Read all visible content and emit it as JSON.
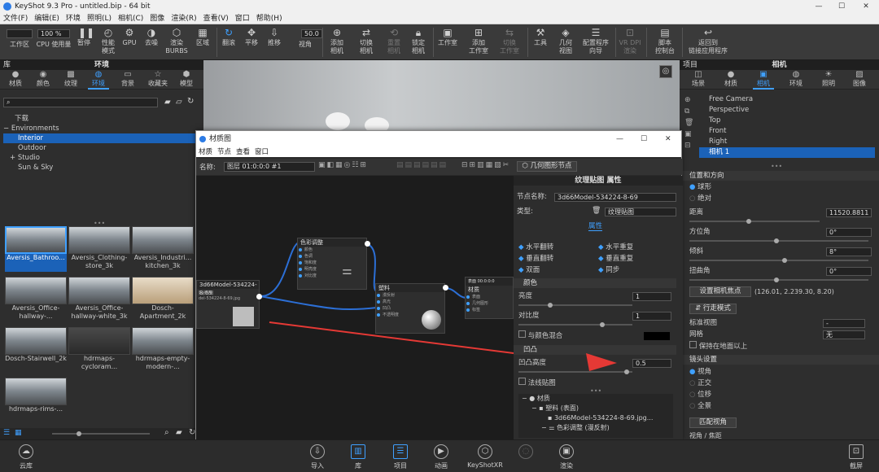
{
  "window": {
    "title": "KeyShot 9.3 Pro - untitled.bip - 64 bit"
  },
  "menu": [
    "文件(F)",
    "编辑(E)",
    "环境",
    "照明(L)",
    "相机(C)",
    "图像",
    "渲染(R)",
    "查看(V)",
    "窗口",
    "帮助(H)"
  ],
  "toolbar": {
    "zoom_value": "100 %",
    "fov_value": "50.0",
    "items": [
      {
        "label": "工作区",
        "icon": "workspace-icon"
      },
      {
        "label": "CPU 使用量",
        "icon": "cpu-icon"
      },
      {
        "label": "暂停",
        "icon": "pause-icon"
      },
      {
        "label": "性能\n模式",
        "icon": "performance-icon"
      },
      {
        "label": "GPU",
        "icon": "gpu-icon"
      },
      {
        "label": "去噪",
        "icon": "denoise-icon"
      },
      {
        "label": "渲染\nBURBS",
        "icon": "nurbs-icon"
      },
      {
        "label": "区域",
        "icon": "region-icon"
      },
      {
        "label": "翻滚",
        "icon": "tumble-icon"
      },
      {
        "label": "平移",
        "icon": "pan-icon"
      },
      {
        "label": "推移",
        "icon": "dolly-icon"
      },
      {
        "label": "视角",
        "icon": "view-icon"
      },
      {
        "label": "添加\n相机",
        "icon": "add-camera-icon"
      },
      {
        "label": "切换\n相机",
        "icon": "switch-camera-icon"
      },
      {
        "label": "重置\n相机",
        "icon": "reset-camera-icon"
      },
      {
        "label": "锁定\n相机",
        "icon": "lock-camera-icon"
      },
      {
        "label": "工作室",
        "icon": "studio-icon"
      },
      {
        "label": "添加\n工作室",
        "icon": "add-studio-icon"
      },
      {
        "label": "切换\n工作室",
        "icon": "switch-studio-icon"
      },
      {
        "label": "工具",
        "icon": "tools-icon"
      },
      {
        "label": "几何\n视图",
        "icon": "geometry-view-icon"
      },
      {
        "label": "配置程序\n向导",
        "icon": "configurator-icon"
      },
      {
        "label": "VR DPI\n渲染",
        "icon": "vr-icon"
      },
      {
        "label": "脚本\n控制台",
        "icon": "script-icon"
      },
      {
        "label": "返回到\n链接应用程序",
        "icon": "return-icon"
      }
    ]
  },
  "library": {
    "panel_title": "库",
    "title": "环境",
    "tabs": [
      "材质",
      "颜色",
      "纹理",
      "环境",
      "背景",
      "收藏夹",
      "模型"
    ],
    "tree": {
      "root": "下载",
      "group": "Environments",
      "items": [
        "Interior",
        "Outdoor",
        "Studio",
        "Sun & Sky"
      ]
    },
    "thumbs": [
      "Aversis_Bathroo...",
      "Aversis_Clothing-store_3k",
      "Aversis_Industri... kitchen_3k",
      "Aversis_Office-hallway-...",
      "Aversis_Office-hallway-white_3k",
      "Dosch-Apartment_2k",
      "Dosch-Stairwell_2k",
      "hdrmaps-cycloram...",
      "hdrmaps-empty-modern-...",
      "hdrmaps-rims-..."
    ]
  },
  "material_window": {
    "title": "材质图",
    "menu": [
      "材质",
      "节点",
      "查看",
      "窗口"
    ],
    "name_label": "名称:",
    "name_value": "图层 01:0:0:0 #1",
    "geometry_node_btn": "几何图形节点",
    "nodes": {
      "texture": {
        "title": "3d66Model-534224-8-69",
        "sub": "贴图图",
        "subtitle": "del-534224-8-69.jpg"
      },
      "color": {
        "title": "色彩调整",
        "inputs": [
          "颜色",
          "色调",
          "饱和度",
          "明亮度",
          "对比度",
          "▪"
        ]
      },
      "plastic": {
        "title": "塑料",
        "inputs": [
          "漫反射",
          "高光",
          "凹凸",
          "不透明度",
          "▪"
        ]
      },
      "material": {
        "title": "材质",
        "header": "表面 00:0:0:0",
        "inputs": [
          "表面",
          "几何图形",
          "标签"
        ]
      }
    },
    "props": {
      "header": "纹理贴图 属性",
      "node_name_label": "节点名称:",
      "node_name_value": "3d66Model-534224-8-69",
      "type_label": "类型:",
      "type_value": "纹理贴图",
      "attr_tab": "属性",
      "flips": [
        "水平翻转",
        "水平重复",
        "垂直翻转",
        "垂直重复",
        "双面",
        "同步"
      ],
      "color_section": "颜色",
      "brightness_label": "亮度",
      "brightness_value": "1",
      "contrast_label": "对比度",
      "contrast_value": "1",
      "blend_label": "与颜色混合",
      "bump_section": "凹凸",
      "bump_height_label": "凹凸高度",
      "bump_height_value": "0.5",
      "normal_map_label": "法线贴图",
      "tree": [
        "材质",
        "塑料 (表面)",
        "3d66Model-534224-8-69.jpg...",
        "色彩调整 (漫反射)"
      ]
    }
  },
  "right": {
    "panel_title": "项目",
    "title": "相机",
    "tabs": [
      "场景",
      "材质",
      "相机",
      "环境",
      "照明",
      "图像"
    ],
    "cameras": [
      "Free Camera",
      "Perspective",
      "Top",
      "Front",
      "Right",
      "相机 1"
    ],
    "pos_section": "位置和方向",
    "spherical": "球形",
    "absolute": "绝对",
    "distance_label": "距离",
    "distance_value": "11520.8811",
    "azimuth_label": "方位角",
    "azimuth_value": "0°",
    "incline_label": "倾斜",
    "incline_value": "8°",
    "twist_label": "扭曲角",
    "twist_value": "0°",
    "set_focus_btn": "设置相机焦点",
    "focus_coords": "(126.01, 2.239.30, 8.20)",
    "walk_btn": "行走模式",
    "std_view_label": "标准视图",
    "std_view_value": "-",
    "grid_label": "网格",
    "grid_value": "无",
    "keep_ground_label": "保持在地面以上",
    "lens_section": "镜头设置",
    "lens_options": [
      "视角",
      "正交",
      "位移",
      "全景"
    ],
    "match_btn": "匹配视角",
    "more": "视角 / 焦距"
  },
  "bottom": [
    "云库",
    "导入",
    "库",
    "项目",
    "动画",
    "KeyShotXR",
    "渲染",
    "截屏"
  ],
  "colors": {
    "accent": "#3fa0ff",
    "arrow": "#e53935",
    "selection": "#1b62b8"
  }
}
